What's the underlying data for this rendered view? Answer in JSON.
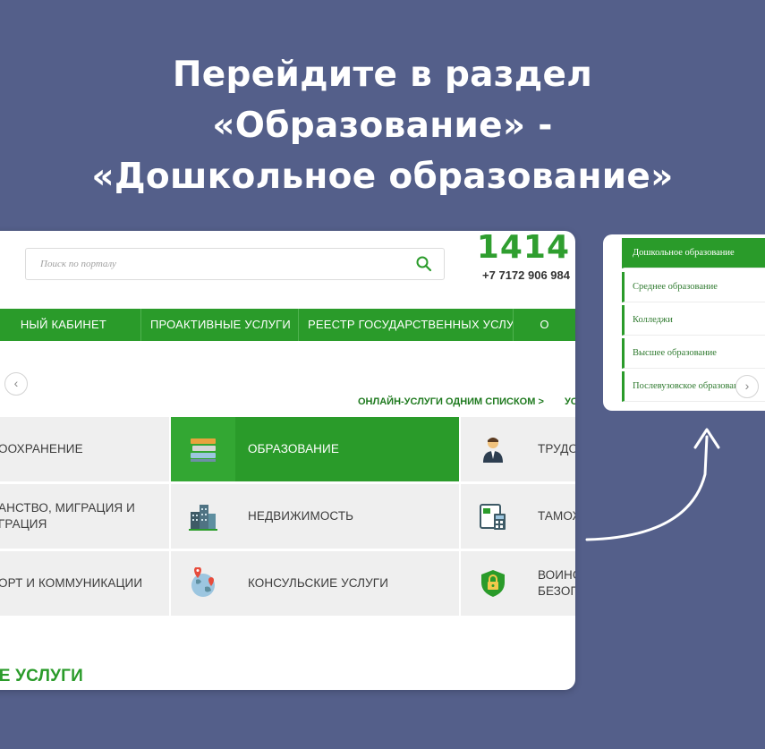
{
  "headline": {
    "line1": "Перейдите в раздел",
    "line2": "«Образование» -",
    "line3": "«Дошкольное образование»"
  },
  "portal": {
    "search_placeholder": "Поиск по порталу",
    "hotline": "1414",
    "phone": "+7 7172 906 984",
    "nav": [
      "НЫЙ КАБИНЕТ",
      "ПРОАКТИВНЫЕ УСЛУГИ",
      "РЕЕСТР ГОСУДАРСТВЕННЫХ УСЛУГ",
      "О"
    ],
    "quick_links": [
      "ОНЛАЙН-УСЛУГИ ОДНИМ СПИСКОМ >",
      "УСЛУ"
    ],
    "categories": {
      "left": [
        "ООХРАНЕНИЕ",
        "АНСТВО, МИГРАЦИЯ И\nГРАЦИЯ",
        "ОРТ И КОММУНИКАЦИИ"
      ],
      "middle": [
        "ОБРАЗОВАНИЕ",
        "НЕДВИЖИМОСТЬ",
        "КОНСУЛЬСКИЕ УСЛУГИ"
      ],
      "right": [
        "ТРУДО",
        "ТАМОЖ",
        "ВОИНС\nБЕЗОП"
      ]
    },
    "section_title": "ЫЕ УСЛУГИ",
    "colors": {
      "green": "#2a9b2a",
      "background": "#545f8a"
    }
  },
  "submenu": {
    "items": [
      "Дошкольное образование",
      "Среднее образование",
      "Колледжи",
      "Высшее образование",
      "Послевузовское образование"
    ]
  }
}
